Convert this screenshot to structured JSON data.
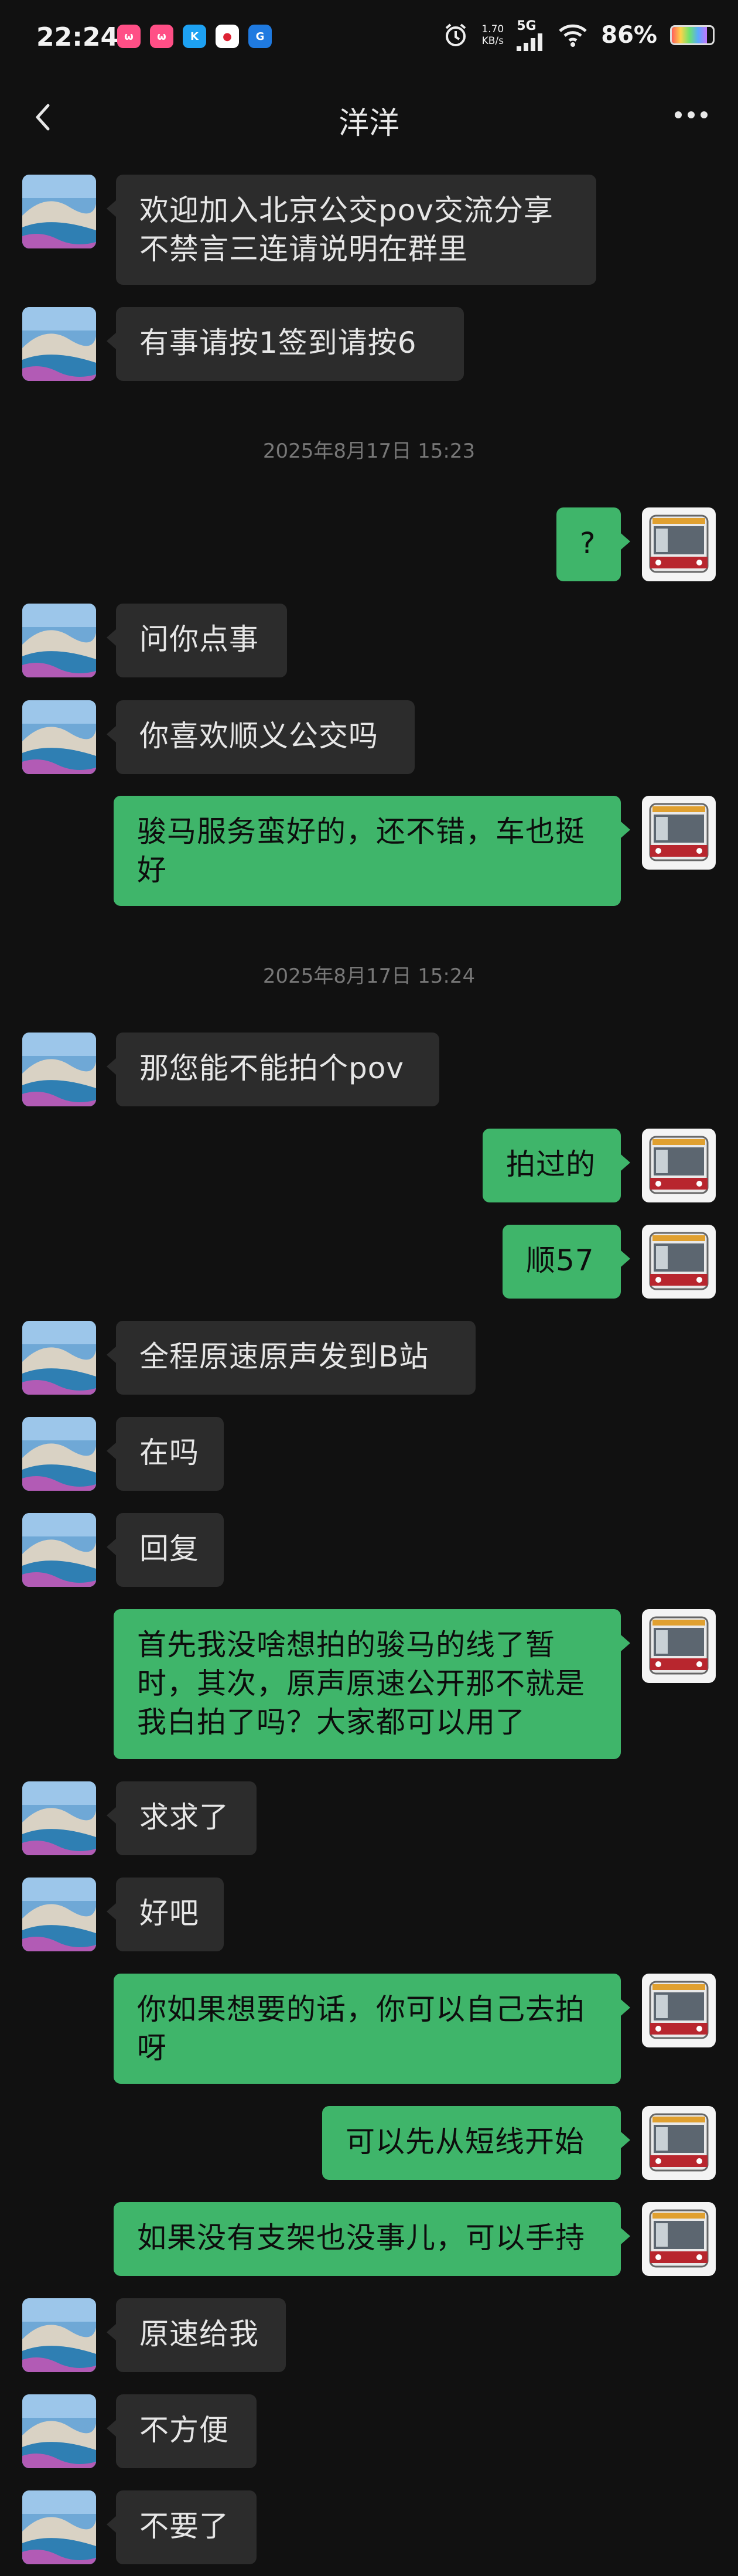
{
  "status_bar": {
    "time": "22:24",
    "net_speed_value": "1.70",
    "net_speed_unit": "KB/s",
    "network": "5G",
    "battery": "86%",
    "battery_level": 0.86
  },
  "header": {
    "title": "洋洋"
  },
  "messages": [
    {
      "side": "other",
      "text": "欢迎加入北京公交pov交流分享不禁言三连请说明在群里"
    },
    {
      "side": "other",
      "text": "有事请按1签到请按6"
    },
    {
      "type": "time",
      "text": "2025年8月17日 15:23"
    },
    {
      "side": "self",
      "text": "?"
    },
    {
      "side": "other",
      "text": "问你点事"
    },
    {
      "side": "other",
      "text": "你喜欢顺义公交吗"
    },
    {
      "side": "self",
      "text": "骏马服务蛮好的，还不错，车也挺好"
    },
    {
      "type": "time",
      "text": "2025年8月17日 15:24"
    },
    {
      "side": "other",
      "text": "那您能不能拍个pov"
    },
    {
      "side": "self",
      "text": "拍过的"
    },
    {
      "side": "self",
      "text": "顺57"
    },
    {
      "side": "other",
      "text": "全程原速原声发到B站"
    },
    {
      "side": "other",
      "text": "在吗"
    },
    {
      "side": "other",
      "text": "回复"
    },
    {
      "side": "self",
      "text": "首先我没啥想拍的骏马的线了暂时，其次，原声原速公开那不就是我白拍了吗？大家都可以用了"
    },
    {
      "side": "other",
      "text": "求求了"
    },
    {
      "side": "other",
      "text": "好吧"
    },
    {
      "side": "self",
      "text": "你如果想要的话，你可以自己去拍呀"
    },
    {
      "side": "self",
      "text": "可以先从短线开始"
    },
    {
      "side": "self",
      "text": "如果没有支架也没事儿，可以手持"
    },
    {
      "side": "other",
      "text": "原速给我"
    },
    {
      "side": "other",
      "text": "不方便"
    },
    {
      "side": "other",
      "text": "不要了"
    }
  ]
}
